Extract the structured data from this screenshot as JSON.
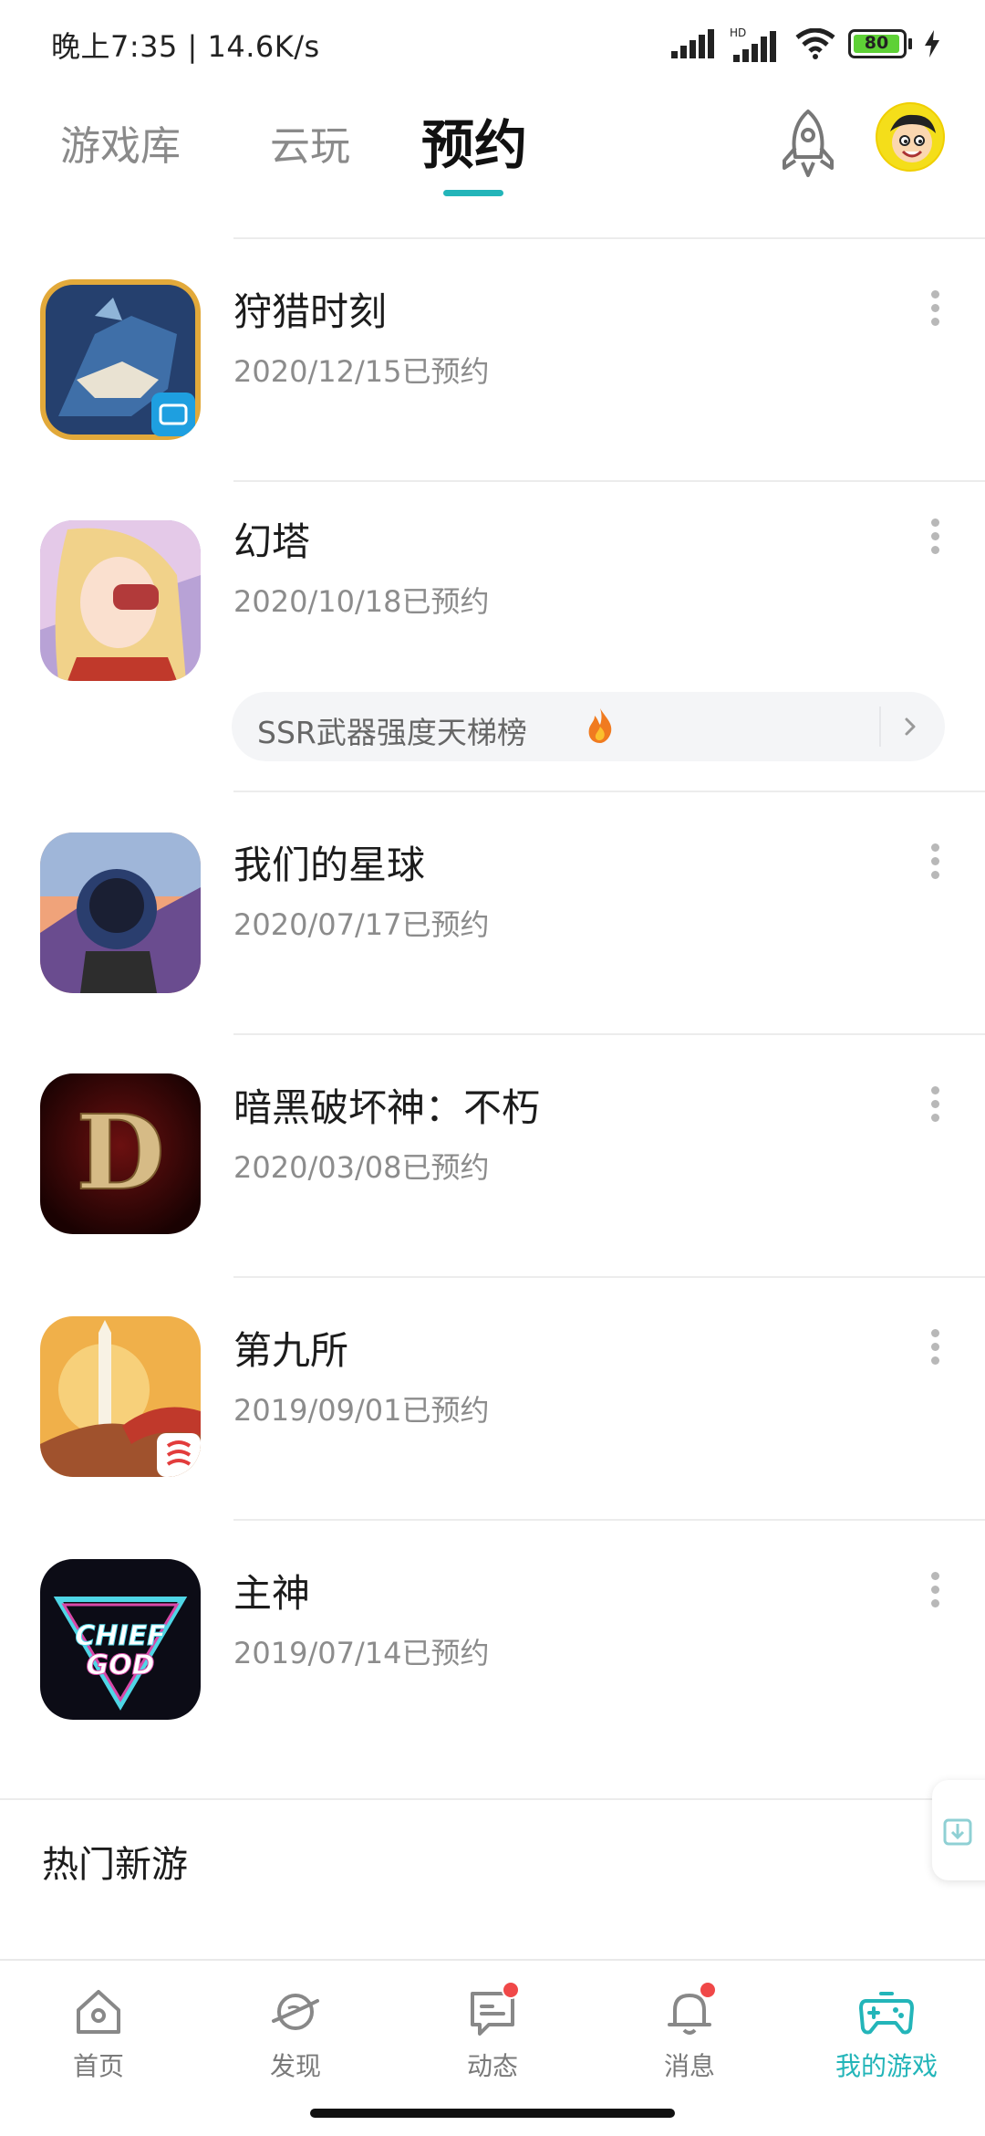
{
  "status_bar": {
    "time_speed": "晚上7:35 | 14.6K/s",
    "signal_icon": "cell-signal-icon",
    "hd_signal_icon": "hd-signal-icon",
    "hd_label": "HD",
    "wifi_icon": "wifi-icon",
    "battery_level": "80",
    "charging_icon": "charging-bolt-icon"
  },
  "header": {
    "tabs": [
      {
        "label": "游戏库",
        "active": false
      },
      {
        "label": "云玩",
        "active": false
      },
      {
        "label": "预约",
        "active": true
      }
    ],
    "accent_color": "#23b5b9"
  },
  "games": [
    {
      "name": "狩猎时刻",
      "date": "2020/12/15已预约",
      "icon": "hunting-moment-icon"
    },
    {
      "name": "幻塔",
      "date": "2020/10/18已预约",
      "icon": "tower-of-fantasy-icon",
      "promo": "SSR武器强度天梯榜"
    },
    {
      "name": "我们的星球",
      "date": "2020/07/17已预约",
      "icon": "our-planet-icon"
    },
    {
      "name": "暗黑破坏神：不朽",
      "date": "2020/03/08已预约",
      "icon": "diablo-immortal-icon",
      "icon_letter": "D"
    },
    {
      "name": "第九所",
      "date": "2019/09/01已预约",
      "icon": "ninth-institute-icon"
    },
    {
      "name": "主神",
      "date": "2019/07/14已预约",
      "icon": "chief-god-icon",
      "icon_text_1": "CHIEF",
      "icon_text_2": "GOD"
    }
  ],
  "section": {
    "hot_new_title": "热门新游"
  },
  "bottom_nav": [
    {
      "label": "首页",
      "icon": "home-icon"
    },
    {
      "label": "发现",
      "icon": "planet-icon"
    },
    {
      "label": "动态",
      "icon": "chat-icon",
      "badge": true
    },
    {
      "label": "消息",
      "icon": "bell-icon",
      "badge": true
    },
    {
      "label": "我的游戏",
      "icon": "gamepad-icon",
      "active": true
    }
  ]
}
